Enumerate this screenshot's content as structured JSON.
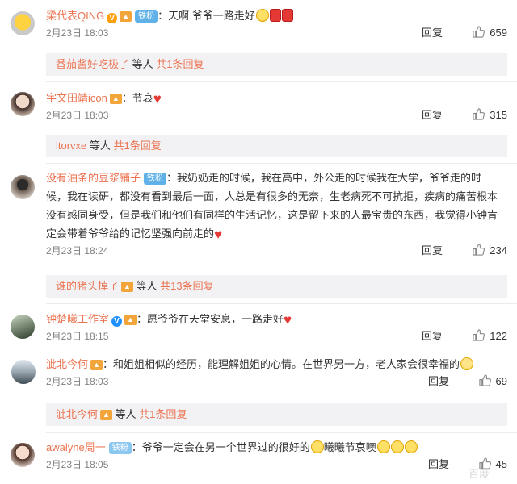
{
  "comments": [
    {
      "user": "梁代表QING",
      "badge": "铁粉",
      "text": "：天啊 爷爷一路走好",
      "date": "2月23日 18:03",
      "reply": "回复",
      "likes": "659",
      "sub_user": "番茄酱好吃极了",
      "sub_text": " 等人 ",
      "sub_count": "共1条回复"
    },
    {
      "user": "宇文田靖icon",
      "text": "：节哀",
      "date": "2月23日 18:03",
      "reply": "回复",
      "likes": "315",
      "sub_user": "ltorvxe",
      "sub_text": " 等人 ",
      "sub_count": "共1条回复"
    },
    {
      "user": "没有油条的豆浆铺子",
      "badge": "铁粉",
      "text_line1": "：我奶奶走的时候，我在高中，外公走的时候我在大学，爷爷走的时",
      "text_line2": "候，我在读研，都没有看到最后一面，人总是有很多的无奈，生老病死不可抗拒，疾病的痛苦根本",
      "text_line3": "没有感同身受，但是我们和他们有同样的生活记忆，这是留下来的人最宝贵的东西，我觉得小钟肯",
      "text_line4": "定会带着爷爷给的记忆坚强向前走的",
      "date": "2月23日 18:24",
      "reply": "回复",
      "likes": "234",
      "sub_user": "谁的猪头掉了",
      "sub_text": " 等人 ",
      "sub_count": "共13条回复"
    },
    {
      "user": "钟楚曦工作室",
      "text": "：愿爷爷在天堂安息，一路走好",
      "date": "2月23日 18:15",
      "reply": "回复",
      "likes": "122"
    },
    {
      "user": "泚北今何",
      "text": "：和姐姐相似的经历，能理解姐姐的心情。在世界另一方，老人家会很幸福的",
      "date": "2月23日 18:03",
      "reply": "回复",
      "likes": "69",
      "sub_user": "泚北今何",
      "sub_text": " 等人 ",
      "sub_count": "共1条回复"
    },
    {
      "user": "awalyne周一",
      "badge": "铁粉",
      "text": "：爷爷一定会在另一个世界过的很好的",
      "text_after": "曦曦节哀噢",
      "date": "2月23日 18:05",
      "reply": "回复",
      "likes": "45"
    }
  ],
  "icons": {
    "verified": "v-badge-icon",
    "like": "thumb-up-icon",
    "cry": "crying-emoji",
    "candle": "candle-emoji",
    "heart": "heart-emoji",
    "smile": "smile-emoji"
  },
  "colors": {
    "username": "#eb7350",
    "meta": "#808080",
    "subreply_bg": "#f2f2f5"
  },
  "watermark": "百度"
}
